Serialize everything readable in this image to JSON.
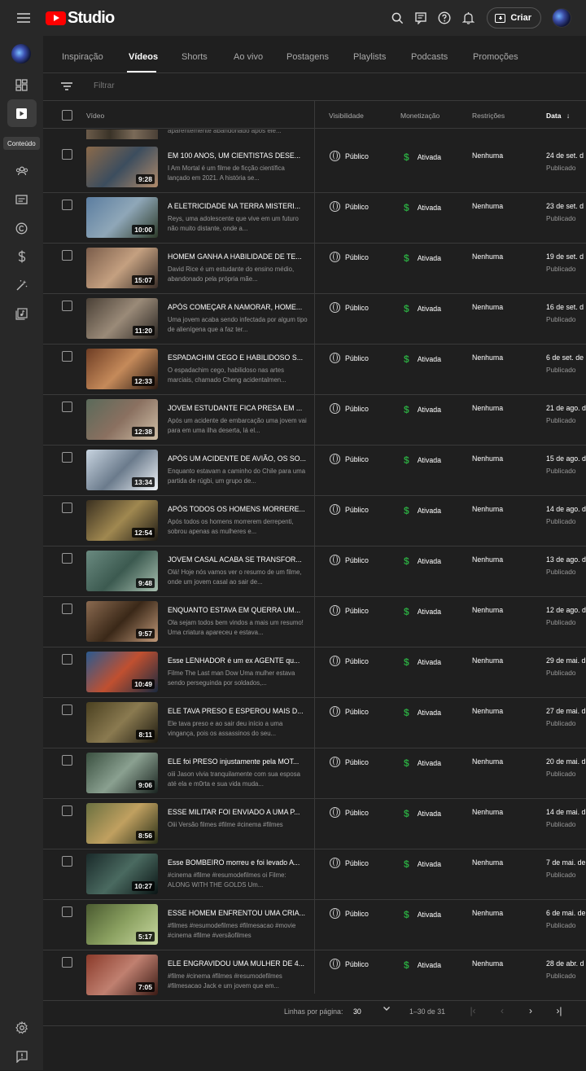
{
  "app": {
    "title": "Studio"
  },
  "header": {
    "create_label": "Criar"
  },
  "sidebar": {
    "tooltip": "Conteúdo"
  },
  "tabs": [
    {
      "label": "Inspiração"
    },
    {
      "label": "Vídeos"
    },
    {
      "label": "Shorts"
    },
    {
      "label": "Ao vivo"
    },
    {
      "label": "Postagens"
    },
    {
      "label": "Playlists"
    },
    {
      "label": "Podcasts"
    },
    {
      "label": "Promoções"
    }
  ],
  "filter": {
    "placeholder": "Filtrar"
  },
  "columns": {
    "video": "Vídeo",
    "visibility": "Visibilidade",
    "monetization": "Monetização",
    "restrictions": "Restrições",
    "date": "Data"
  },
  "partial_row_text": "aparentemente abandonado após ele...",
  "rows": [
    {
      "title": "EM 100 ANOS, UM CIENTISTAS DESE...",
      "desc": "I Am Mortal é um filme de ficção científica lançado em 2021. A história se...",
      "duration": "9:28",
      "visibility": "Público",
      "monetization": "Ativada",
      "restrictions": "Nenhuma",
      "date": "24 de set. d",
      "status": "Publicado"
    },
    {
      "title": "A ELETRICIDADE NA TERRA MISTERI...",
      "desc": "Reys, uma adolescente que vive em um futuro não muito distante, onde a...",
      "duration": "10:00",
      "visibility": "Público",
      "monetization": "Ativada",
      "restrictions": "Nenhuma",
      "date": "23 de set. d",
      "status": "Publicado"
    },
    {
      "title": "HOMEM GANHA A HABILIDADE DE TE...",
      "desc": "David Rice é um estudante do ensino médio, abandonado pela própria mãe...",
      "duration": "15:07",
      "visibility": "Público",
      "monetization": "Ativada",
      "restrictions": "Nenhuma",
      "date": "19 de set. d",
      "status": "Publicado"
    },
    {
      "title": "APÓS COMEÇAR A NAMORAR, HOME...",
      "desc": "Uma jovem acaba sendo infectada por algum tipo de alienígena que a faz ter...",
      "duration": "11:20",
      "visibility": "Público",
      "monetization": "Ativada",
      "restrictions": "Nenhuma",
      "date": "16 de set. d",
      "status": "Publicado"
    },
    {
      "title": "ESPADACHIM CEGO E HABILIDOSO S...",
      "desc": "O espadachim cego, habilidoso nas artes marciais, chamado Cheng acidentalmen...",
      "duration": "12:33",
      "visibility": "Público",
      "monetization": "Ativada",
      "restrictions": "Nenhuma",
      "date": "6 de set. de",
      "status": "Publicado"
    },
    {
      "title": "JOVEM ESTUDANTE FICA PRESA EM ...",
      "desc": "Após um acidente de embarcação uma jovem vai para em uma ilha deserta, lá el...",
      "duration": "12:38",
      "visibility": "Público",
      "monetization": "Ativada",
      "restrictions": "Nenhuma",
      "date": "21 de ago. d",
      "status": "Publicado"
    },
    {
      "title": "APÓS UM ACIDENTE DE AVIÃO, OS SO...",
      "desc": "Enquanto estavam a caminho do Chile para uma partida de rúgbi, um grupo de...",
      "duration": "13:34",
      "visibility": "Público",
      "monetization": "Ativada",
      "restrictions": "Nenhuma",
      "date": "15 de ago. d",
      "status": "Publicado"
    },
    {
      "title": "APÓS TODOS OS HOMENS MORRERE...",
      "desc": "Após todos os homens morrerem derrepenti, sobrou apenas as mulheres e...",
      "duration": "12:54",
      "visibility": "Público",
      "monetization": "Ativada",
      "restrictions": "Nenhuma",
      "date": "14 de ago. d",
      "status": "Publicado"
    },
    {
      "title": "JOVEM CASAL ACABA SE TRANSFOR...",
      "desc": "Olá! Hoje nós vamos ver o resumo de um filme, onde um jovem casal ao sair de...",
      "duration": "9:48",
      "visibility": "Público",
      "monetization": "Ativada",
      "restrictions": "Nenhuma",
      "date": "13 de ago. d",
      "status": "Publicado"
    },
    {
      "title": "ENQUANTO ESTAVA EM QUERRA UM...",
      "desc": "Ola sejam todos bem vindos a mais um resumo! Uma criatura apareceu e estava...",
      "duration": "9:57",
      "visibility": "Público",
      "monetization": "Ativada",
      "restrictions": "Nenhuma",
      "date": "12 de ago. d",
      "status": "Publicado"
    },
    {
      "title": "Esse LENHADOR é um ex AGENTE qu...",
      "desc": "Filme The Last man Dow Uma mulher estava sendo perseguinda por soldados,...",
      "duration": "10:49",
      "visibility": "Público",
      "monetization": "Ativada",
      "restrictions": "Nenhuma",
      "date": "29 de mai. d",
      "status": "Publicado"
    },
    {
      "title": "ELE TAVA PRESO E ESPEROU MAIS D...",
      "desc": "Ele tava preso e ao sair deu início a uma vingança, pois os assassinos do seu...",
      "duration": "8:11",
      "visibility": "Público",
      "monetization": "Ativada",
      "restrictions": "Nenhuma",
      "date": "27 de mai. d",
      "status": "Publicado"
    },
    {
      "title": "ELE foi PRESO injustamente pela MOT...",
      "desc": "oiii Jason vivia tranquilamente com sua esposa até ela e m0rta e sua vida muda...",
      "duration": "9:06",
      "visibility": "Público",
      "monetization": "Ativada",
      "restrictions": "Nenhuma",
      "date": "20 de mai. d",
      "status": "Publicado"
    },
    {
      "title": "ESSE MILITAR FOI ENVIADO A UMA P...",
      "desc": "Oiii Versão filmes #filme #cinema #filmes",
      "duration": "8:56",
      "visibility": "Público",
      "monetization": "Ativada",
      "restrictions": "Nenhuma",
      "date": "14 de mai. d",
      "status": "Publicado"
    },
    {
      "title": "Esse BOMBEIRO morreu e foi levado A...",
      "desc": "#cinema #filme #resumodefilmes oi Filme: ALONG WITH THE GOLDS Um...",
      "duration": "10:27",
      "visibility": "Público",
      "monetization": "Ativada",
      "restrictions": "Nenhuma",
      "date": "7 de mai. de",
      "status": "Publicado"
    },
    {
      "title": "ESSE HOMEM ENFRENTOU UMA CRIA...",
      "desc": "#filmes #resumodefilmes #filmesacao #movie #cinema #filme #versãofilmes",
      "duration": "5:17",
      "visibility": "Público",
      "monetization": "Ativada",
      "restrictions": "Nenhuma",
      "date": "6 de mai. de",
      "status": "Publicado"
    },
    {
      "title": "ELE ENGRAVIDOU UMA MULHER DE 4...",
      "desc": "#filme #cinema #filmes #resumodefilmes #filmesacao Jack e um jovem que em...",
      "duration": "7:05",
      "visibility": "Público",
      "monetization": "Ativada",
      "restrictions": "Nenhuma",
      "date": "28 de abr. d",
      "status": "Publicado"
    }
  ],
  "footer": {
    "rows_per_page_label": "Linhas por página:",
    "rows_per_page_value": "30",
    "range": "1–30 de 31"
  },
  "colors": {
    "accent_red": "#ff0000",
    "money_green": "#2ba640",
    "background": "#1f1f1f",
    "panel": "#282828"
  }
}
